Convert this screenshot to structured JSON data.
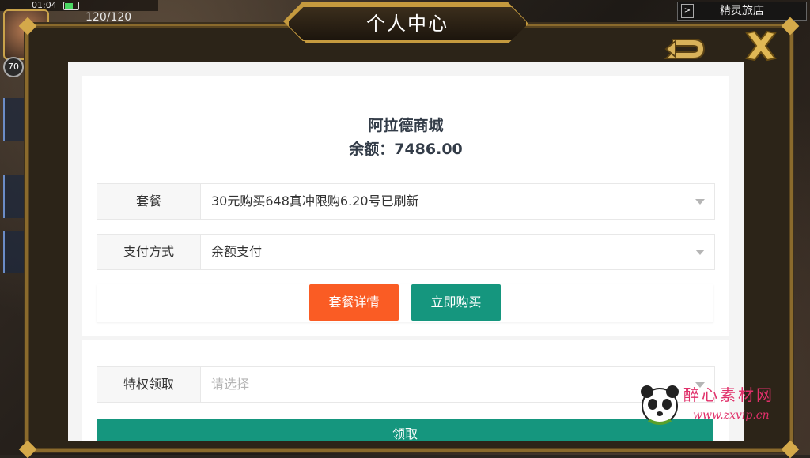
{
  "hud": {
    "time": "01:04",
    "energy": "120/120",
    "level": "70",
    "inn_label": "精灵旅店"
  },
  "modal": {
    "title": "个人中心"
  },
  "shop": {
    "name": "阿拉德商城",
    "balance": "余额：7486.00"
  },
  "form": {
    "package_label": "套餐",
    "package_value": "30元购买648真冲限购6.20号已刷新",
    "payment_label": "支付方式",
    "payment_value": "余额支付",
    "details_button": "套餐详情",
    "buy_button": "立即购买",
    "privilege_label": "特权领取",
    "privilege_placeholder": "请选择",
    "claim_button": "领取"
  },
  "watermark": {
    "title": "醉心素材网",
    "url": "www.zxvip.cn"
  },
  "colors": {
    "accent_orange": "#fa5c24",
    "accent_teal": "#15967e",
    "frame_gold": "#c59a3e"
  }
}
